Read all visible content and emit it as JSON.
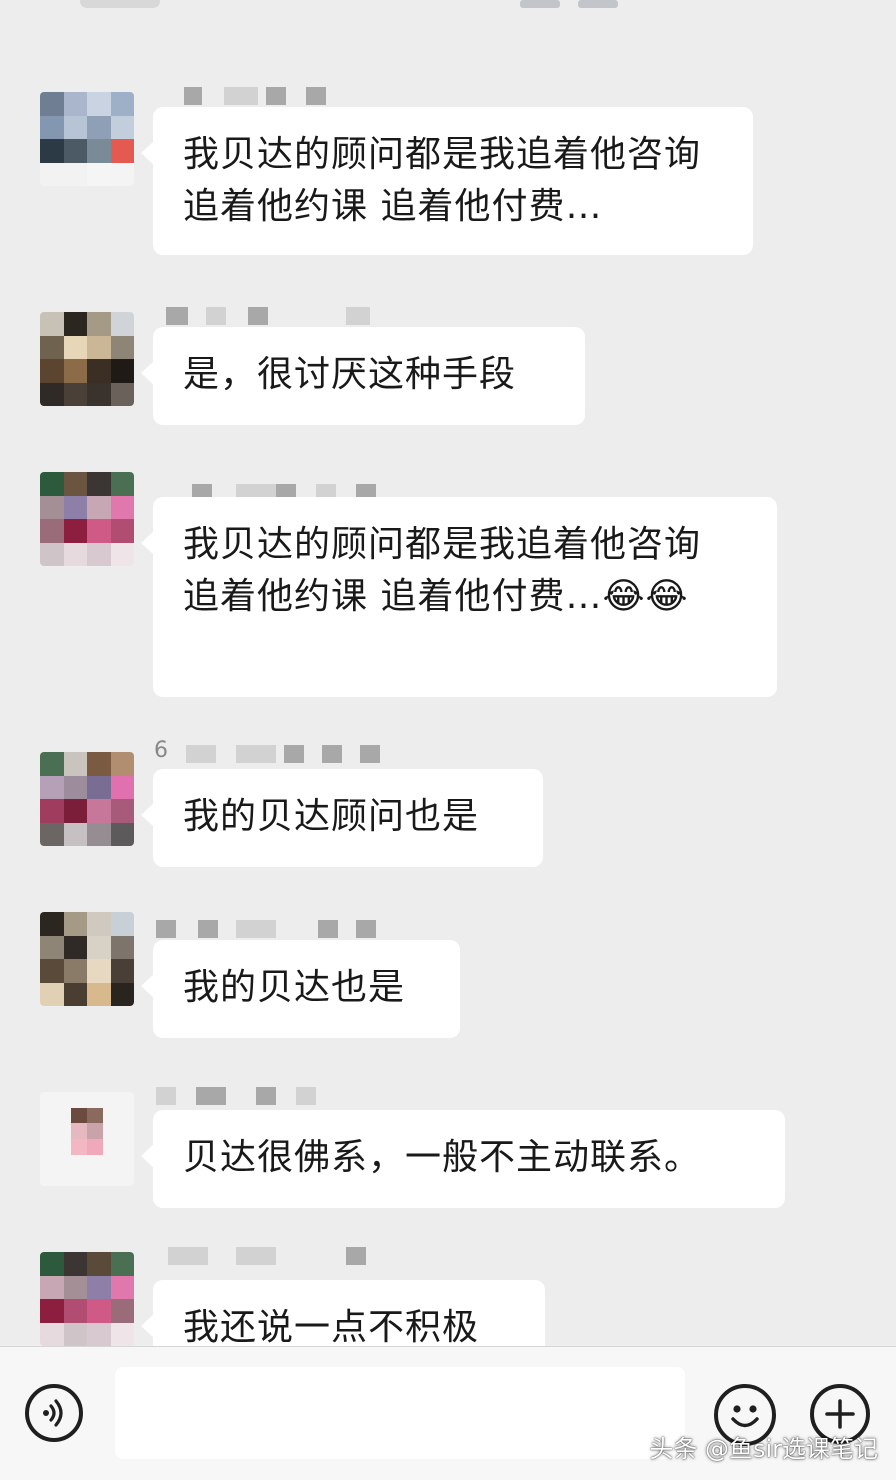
{
  "messages": [
    {
      "text": "我贝达的顾问都是我追着他咨询 追着他约课 追着他付费…",
      "emoji": ""
    },
    {
      "text": "是，很讨厌这种手段",
      "emoji": ""
    },
    {
      "text": "我贝达的顾问都是我追着他咨询 追着他约课 追着他付费…",
      "emoji": "😂😂"
    },
    {
      "text": "我的贝达顾问也是",
      "emoji": "",
      "nickname_visible": "6"
    },
    {
      "text": "我的贝达也是",
      "emoji": ""
    },
    {
      "text": "贝达很佛系，一般不主动联系。",
      "emoji": ""
    },
    {
      "text": "我还说一点不积极",
      "emoji": ""
    }
  ],
  "icons": {
    "voice": "voice-icon",
    "emoji": "smiley-icon",
    "plus": "plus-icon"
  },
  "watermark": "头条 @鱼sir选课笔记",
  "colors": {
    "background": "#ededed",
    "bubble": "#ffffff",
    "text": "#191919"
  }
}
